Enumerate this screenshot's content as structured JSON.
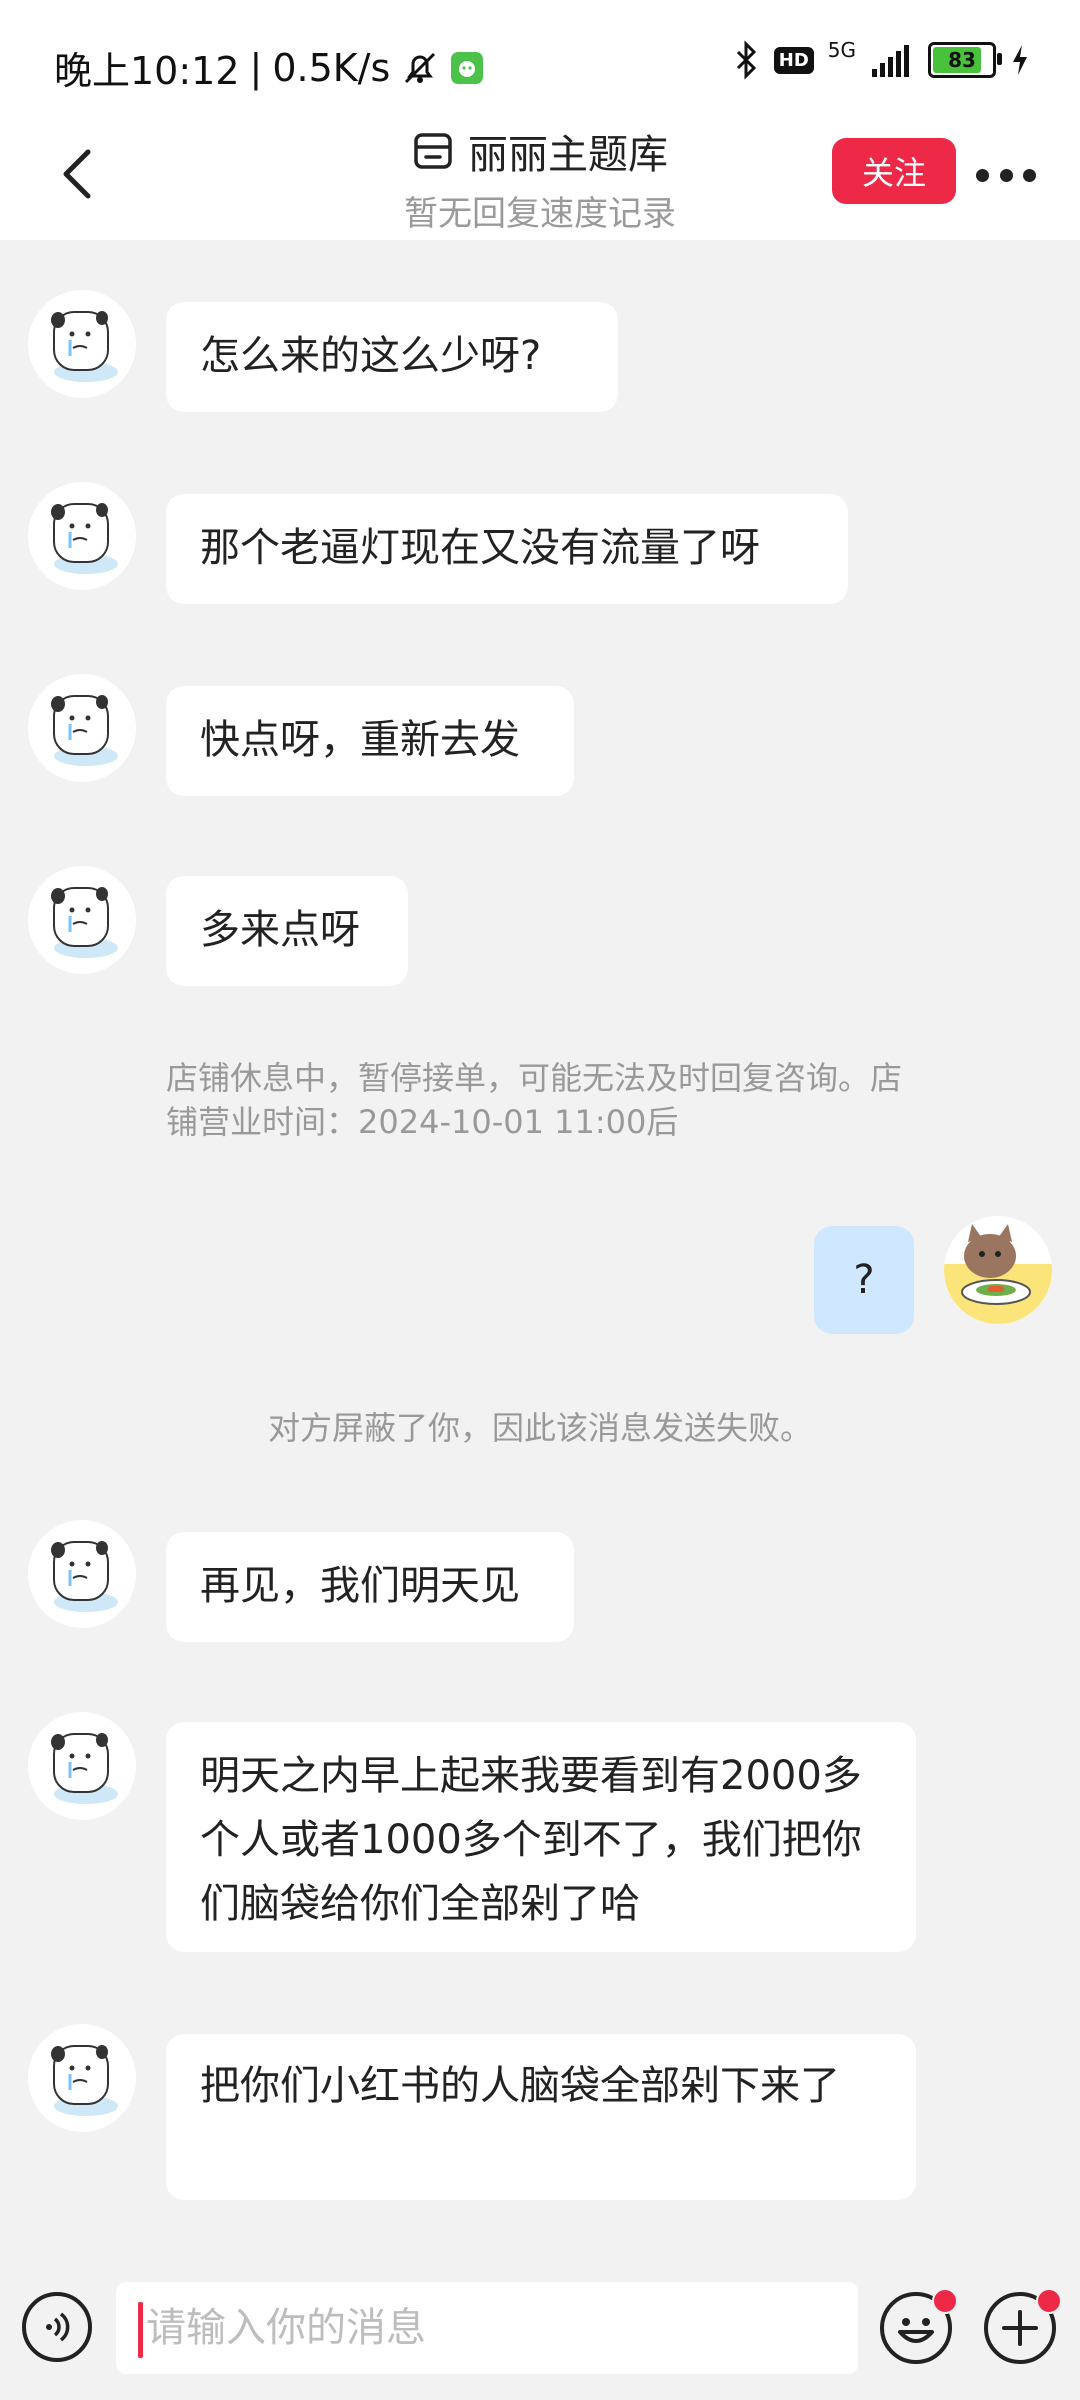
{
  "status_bar": {
    "time": "晚上10:12",
    "network_speed": "0.5K/s",
    "separator": "|",
    "battery": "83",
    "network_type": "5G",
    "hd": "HD"
  },
  "header": {
    "shop_name": "丽丽主题库",
    "subtitle": "暂无回复速度记录",
    "follow_label": "关注"
  },
  "messages": [
    {
      "from": "shop",
      "text": "怎么来的这么少呀?"
    },
    {
      "from": "shop",
      "text": "那个老逼灯现在又没有流量了呀"
    },
    {
      "from": "shop",
      "text": "快点呀，重新去发"
    },
    {
      "from": "shop",
      "text": "多来点呀"
    },
    {
      "from": "system",
      "text": "店铺休息中，暂停接单，可能无法及时回复咨询。店铺营业时间：2024-10-01 11:00后"
    },
    {
      "from": "me",
      "text": "?"
    },
    {
      "from": "system",
      "text": "对方屏蔽了你，因此该消息发送失败。"
    },
    {
      "from": "shop",
      "text": "再见，我们明天见"
    },
    {
      "from": "shop",
      "text": "明天之内早上起来我要看到有2000多个人或者1000多个到不了，我们把你们脑袋给你们全部剁了哈"
    },
    {
      "from": "shop",
      "text": "把你们小红书的人脑袋全部剁下来了"
    }
  ],
  "input": {
    "placeholder": "请输入你的消息"
  },
  "icons": {
    "back": "chevron-left-icon",
    "store": "store-icon",
    "more": "more-dots-icon",
    "voice": "voice-icon",
    "emoji": "emoji-icon",
    "plus": "plus-icon"
  },
  "colors": {
    "accent": "#ee2948",
    "my_bubble": "#cfe8ff",
    "background": "#f2f2f2"
  }
}
